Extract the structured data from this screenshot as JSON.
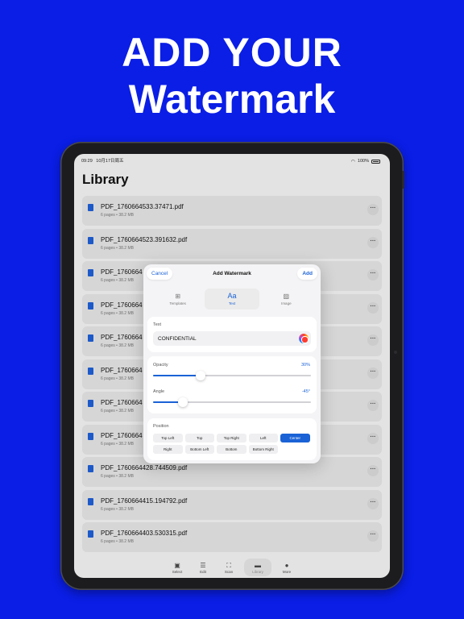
{
  "headline": {
    "line1": "ADD YOUR",
    "line2": "Watermark"
  },
  "status_bar": {
    "time": "09:29",
    "date": "10月17日周五",
    "battery": "100%"
  },
  "library": {
    "title": "Library",
    "files": [
      {
        "name": "PDF_1760664533.37471.pdf",
        "meta": "6 pages • 38.2 MB"
      },
      {
        "name": "PDF_1760664523.391632.pdf",
        "meta": "6 pages • 38.2 MB"
      },
      {
        "name": "PDF_1760664",
        "meta": "6 pages • 38.2 MB"
      },
      {
        "name": "PDF_1760664",
        "meta": "6 pages • 38.2 MB"
      },
      {
        "name": "PDF_1760664",
        "meta": "6 pages • 38.2 MB"
      },
      {
        "name": "PDF_1760664",
        "meta": "6 pages • 38.2 MB"
      },
      {
        "name": "PDF_1760664",
        "meta": "6 pages • 38.2 MB"
      },
      {
        "name": "PDF_1760664",
        "meta": "6 pages • 38.2 MB"
      },
      {
        "name": "PDF_1760664428.744509.pdf",
        "meta": "6 pages • 38.2 MB"
      },
      {
        "name": "PDF_1760664415.194792.pdf",
        "meta": "6 pages • 38.2 MB"
      },
      {
        "name": "PDF_1760664403.530315.pdf",
        "meta": "6 pages • 38.2 MB"
      }
    ],
    "more_icon": "ellipsis-icon"
  },
  "tab_bar": {
    "items": [
      {
        "label": "Select",
        "icon": "select-icon",
        "glyph": "▣"
      },
      {
        "label": "Edit",
        "icon": "list-icon",
        "glyph": "☰"
      },
      {
        "label": "Scan",
        "icon": "scan-icon",
        "glyph": "⛶"
      },
      {
        "label": "Library",
        "icon": "folder-icon",
        "glyph": "▬"
      },
      {
        "label": "More",
        "icon": "more-circle-icon",
        "glyph": "●"
      }
    ],
    "active": "Library"
  },
  "modal": {
    "title": "Add Watermark",
    "cancel": "Cancel",
    "add": "Add",
    "segments": [
      {
        "label": "Templates",
        "icon": "grid-icon",
        "glyph": "⊞"
      },
      {
        "label": "Text",
        "icon": "text-icon",
        "glyph": "Aa"
      },
      {
        "label": "Image",
        "icon": "image-icon",
        "glyph": "▨"
      }
    ],
    "active_segment": "Text",
    "text_section": {
      "label": "Text",
      "value": "CONFIDENTIAL"
    },
    "opacity": {
      "label": "Opacity",
      "value_text": "30%",
      "value": 0.3
    },
    "angle": {
      "label": "Angle",
      "value_text": "-45°",
      "value": -45,
      "min": -180,
      "max": 180
    },
    "position": {
      "label": "Position",
      "row1": [
        "Top Left",
        "Top",
        "Top Right",
        "Left",
        "Center"
      ],
      "row2": [
        "Right",
        "Bottom Left",
        "Bottom",
        "Bottom Right"
      ],
      "selected": "Center"
    }
  },
  "colors": {
    "brand_background": "#0a1ee6",
    "accent": "#1a62d6",
    "file_icon": "#1f5fd6"
  }
}
